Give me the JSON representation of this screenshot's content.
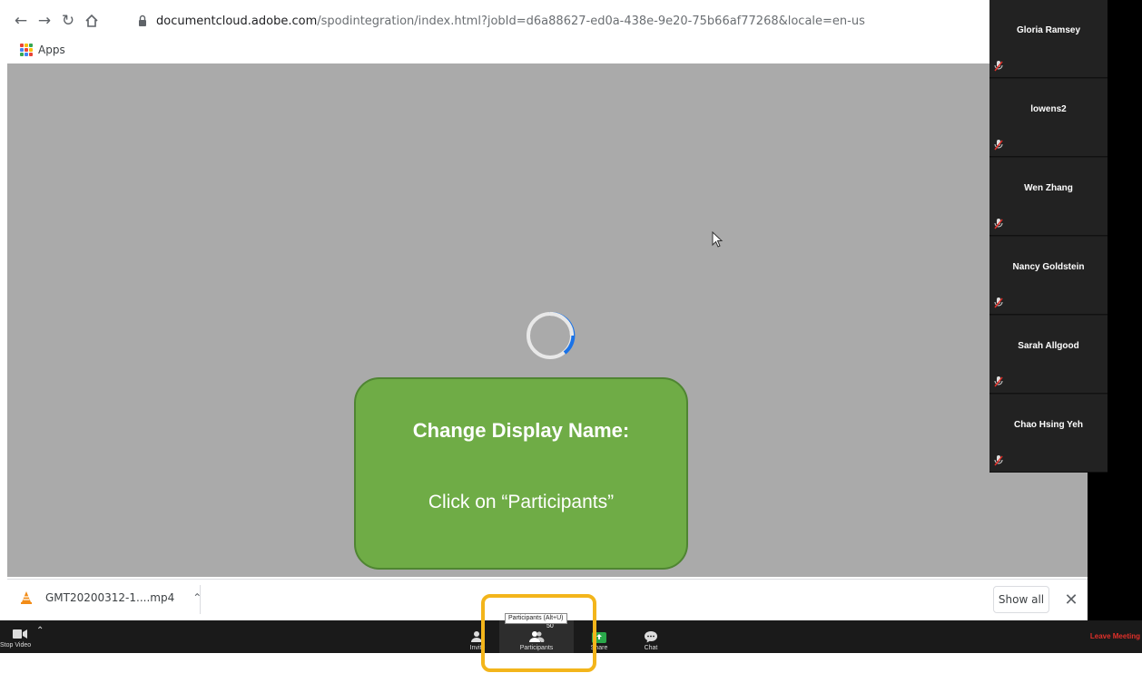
{
  "browser": {
    "url_domain": "documentcloud.adobe.com",
    "url_path": "/spodintegration/index.html?jobId=d6a88627-ed0a-438e-9e20-75b66af77268&locale=en-us",
    "bookmarks_apps_label": "Apps"
  },
  "callout": {
    "title": "Change Display Name:",
    "instruction": "Click on “Participants”",
    "color": "#6fac46"
  },
  "participants_strip": [
    {
      "name": "Gloria Ramsey"
    },
    {
      "name": "lowens2"
    },
    {
      "name": "Wen Zhang"
    },
    {
      "name": "Nancy Goldstein"
    },
    {
      "name": "Sarah Allgood"
    },
    {
      "name": "Chao Hsing Yeh"
    }
  ],
  "downloads": {
    "file_name": "GMT20200312-1....mp4",
    "show_all_label": "Show all"
  },
  "toolbar": {
    "stop_video_label": "Stop Video",
    "invite_label": "Invite",
    "participants_label": "Participants",
    "participants_count": "50",
    "participants_tooltip": "Participants (Alt+U)",
    "share_label": "Share",
    "chat_label": "Chat",
    "leave_label": "Leave Meeting",
    "leave_color": "#e0302a"
  },
  "highlight_color": "#f3b51b"
}
